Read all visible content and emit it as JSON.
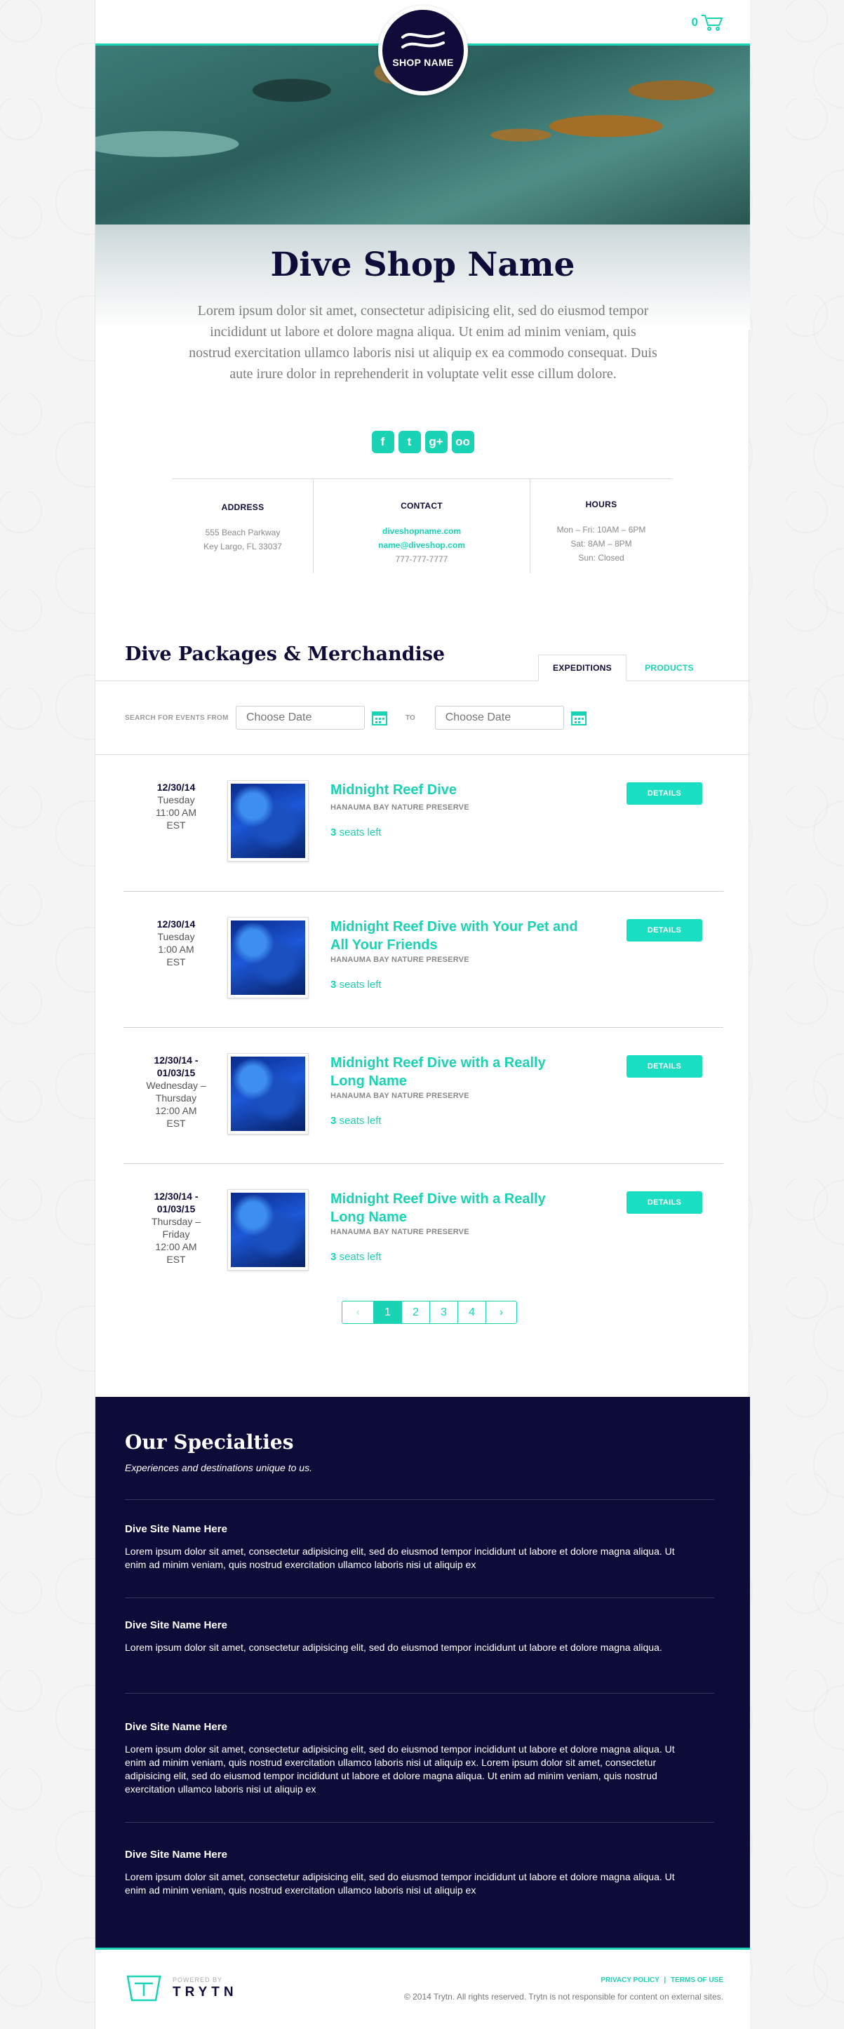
{
  "header": {
    "cart_count": "0",
    "logo_text": "SHOP NAME"
  },
  "hero": {
    "title": "Dive Shop Name",
    "description": "Lorem ipsum dolor sit amet, consectetur adipisicing elit, sed do eiusmod tempor incididunt ut labore et dolore magna aliqua. Ut enim ad minim veniam, quis nostrud exercitation ullamco laboris nisi ut aliquip ex ea commodo consequat. Duis aute irure dolor in reprehenderit in voluptate velit esse cillum dolore.",
    "social": [
      {
        "name": "facebook-icon",
        "glyph": "f"
      },
      {
        "name": "twitter-icon",
        "glyph": "t"
      },
      {
        "name": "google-plus-icon",
        "glyph": "g+"
      },
      {
        "name": "tripadvisor-icon",
        "glyph": "oo"
      }
    ]
  },
  "info": {
    "address": {
      "label": "ADDRESS",
      "line1": "555 Beach Parkway",
      "line2": "Key Largo, FL 33037"
    },
    "contact": {
      "label": "CONTACT",
      "website": "diveshopname.com",
      "email": "name@diveshop.com",
      "phone": "777-777-7777"
    },
    "hours": {
      "label": "HOURS",
      "line1": "Mon – Fri: 10AM – 6PM",
      "line2": "Sat: 8AM – 8PM",
      "line3": "Sun: Closed"
    }
  },
  "packages": {
    "title": "Dive Packages & Merchandise",
    "tabs": [
      {
        "label": "EXPEDITIONS",
        "active": true
      },
      {
        "label": "PRODUCTS",
        "active": false
      }
    ],
    "search_label": "SEARCH FOR EVENTS FROM",
    "date_from_placeholder": "Choose Date",
    "to_label": "TO",
    "date_to_placeholder": "Choose Date"
  },
  "events": [
    {
      "date": "12/30/14",
      "day": "Tuesday",
      "time": "11:00 AM",
      "tz": "EST",
      "title": "Midnight Reef Dive",
      "location": "HANAUMA BAY NATURE PRESERVE",
      "seats_num": "3",
      "seats_text": " seats left",
      "button": "DETAILS"
    },
    {
      "date": "12/30/14",
      "day": "Tuesday",
      "time": "1:00 AM",
      "tz": "EST",
      "title": "Midnight Reef Dive with Your Pet and All Your Friends",
      "location": "HANAUMA BAY NATURE PRESERVE",
      "seats_num": "3",
      "seats_text": " seats left",
      "button": "DETAILS"
    },
    {
      "date": "12/30/14 -",
      "date2": "01/03/15",
      "day": "Wednesday –",
      "day2": "Thursday",
      "time": "12:00 AM",
      "tz": "EST",
      "title": "Midnight Reef Dive with a Really Long Name",
      "location": "HANAUMA BAY NATURE PRESERVE",
      "seats_num": "3",
      "seats_text": " seats left",
      "button": "DETAILS"
    },
    {
      "date": "12/30/14 -",
      "date2": "01/03/15",
      "day": "Thursday –",
      "day2": "Friday",
      "time": "12:00 AM",
      "tz": "EST",
      "title": "Midnight Reef Dive with a Really Long Name",
      "location": "HANAUMA BAY NATURE PRESERVE",
      "seats_num": "3",
      "seats_text": " seats left",
      "button": "DETAILS"
    }
  ],
  "pagination": {
    "prev": "‹",
    "pages": [
      "1",
      "2",
      "3",
      "4"
    ],
    "active": "1",
    "next": "›"
  },
  "specialties": {
    "title": "Our Specialties",
    "subtitle": "Experiences and destinations unique to us.",
    "items": [
      {
        "name": "Dive Site Name Here",
        "text": "Lorem ipsum dolor sit amet, consectetur adipisicing elit, sed do eiusmod tempor incididunt ut labore et dolore magna aliqua. Ut enim ad minim veniam, quis nostrud exercitation ullamco laboris nisi ut aliquip ex"
      },
      {
        "name": "Dive Site Name Here",
        "text": "Lorem ipsum dolor sit amet, consectetur adipisicing elit, sed do eiusmod tempor incididunt ut labore et dolore magna aliqua."
      },
      {
        "name": "Dive Site Name Here",
        "text": "Lorem ipsum dolor sit amet, consectetur adipisicing elit, sed do eiusmod tempor incididunt ut labore et dolore magna aliqua. Ut enim ad minim veniam, quis nostrud exercitation ullamco laboris nisi ut aliquip ex. Lorem ipsum dolor sit amet, consectetur adipisicing elit, sed do eiusmod tempor incididunt ut labore et dolore magna aliqua. Ut enim ad minim veniam, quis nostrud exercitation ullamco laboris nisi ut aliquip ex"
      },
      {
        "name": "Dive Site Name Here",
        "text": "Lorem ipsum dolor sit amet, consectetur adipisicing elit, sed do eiusmod tempor incididunt ut labore et dolore magna aliqua. Ut enim ad minim veniam, quis nostrud exercitation ullamco laboris nisi ut aliquip ex"
      }
    ]
  },
  "footer": {
    "powered_by": "POWERED BY",
    "brand": "TRYTN",
    "privacy": "PRIVACY POLICY",
    "link_sep": "|",
    "terms": "TERMS OF USE",
    "copyright": "© 2014 Trytn. All rights reserved. Trytn is not responsible for content on external sites."
  },
  "colors": {
    "accent": "#19d3b4",
    "navy": "#0f0c39"
  }
}
